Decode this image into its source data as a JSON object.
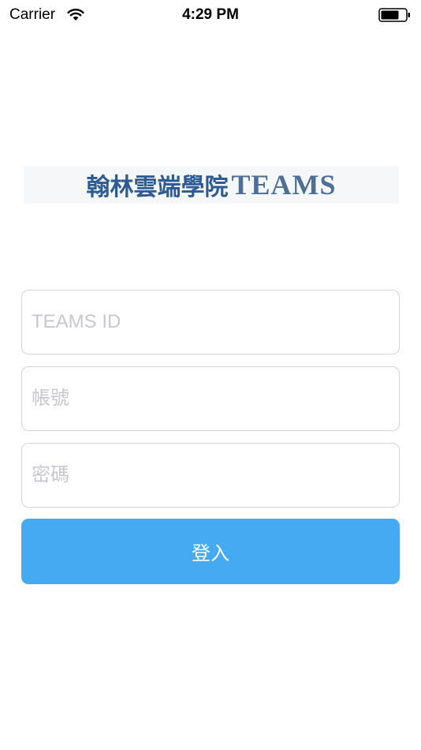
{
  "status_bar": {
    "carrier": "Carrier",
    "time": "4:29 PM",
    "wifi_icon": "wifi-icon",
    "battery_icon": "battery-icon"
  },
  "logo": {
    "chinese": "翰林雲端學院",
    "latin": "TEAMS",
    "color": "#2d5b93"
  },
  "form": {
    "teams_id_placeholder": "TEAMS ID",
    "account_placeholder": "帳號",
    "password_placeholder": "密碼",
    "login_label": "登入"
  },
  "colors": {
    "button": "#45aaf2",
    "field_border": "#d5d5d5",
    "placeholder": "#c7c7cd"
  }
}
